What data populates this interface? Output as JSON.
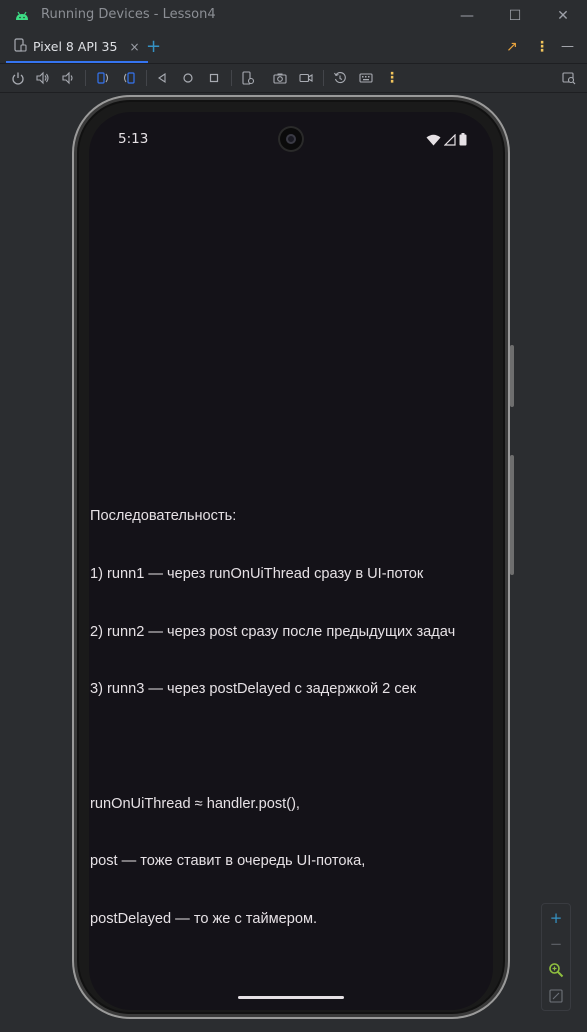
{
  "window": {
    "title": "Running Devices - Lesson4",
    "minimize_label": "—",
    "maximize_label": "☐",
    "close_label": "✕"
  },
  "tabs": [
    {
      "label": "Pixel 8 API 35",
      "close_label": "×"
    }
  ],
  "tabbar": {
    "add_label": "+",
    "more_label": "⋮"
  },
  "toolbar": {
    "more_label": "⋮"
  },
  "device": {
    "status_time": "5:13",
    "content_lines": [
      "Последовательность:",
      "1) runn1 — через runOnUiThread сразу в UI-поток",
      "2) runn2 — через post сразу после предыдущих задач",
      "3) runn3 — через postDelayed с задержкой 2 сек",
      "",
      "runOnUiThread ≈ handler.post(),",
      "post — тоже ставит в очередь UI-потока,",
      "postDelayed — то же с таймером."
    ]
  },
  "zoom": {
    "zoom_in_label": "+",
    "zoom_out_label": "−"
  },
  "colors": {
    "accent": "#3574f0",
    "screen_bg": "#141218",
    "text": "#e6e1e5",
    "android_green": "#3ddc84",
    "orange": "#e8a33d",
    "yellow": "#f2c55c"
  }
}
